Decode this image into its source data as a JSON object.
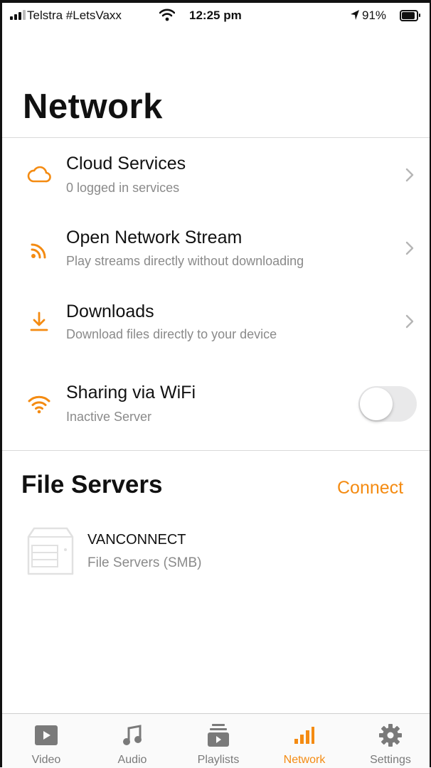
{
  "status_bar": {
    "carrier": "Telstra #LetsVaxx",
    "time": "12:25 pm",
    "battery_pct": "91%"
  },
  "page": {
    "title": "Network"
  },
  "colors": {
    "accent": "#f48b12",
    "secondary_text": "#8a8a8a",
    "toggle_off": "#e9e9ea"
  },
  "network_items": [
    {
      "title": "Cloud Services",
      "subtitle": "0 logged in services",
      "icon": "cloud-icon"
    },
    {
      "title": "Open Network Stream",
      "subtitle": "Play streams directly without downloading",
      "icon": "stream-icon"
    },
    {
      "title": "Downloads",
      "subtitle": "Download files directly to your device",
      "icon": "download-icon"
    },
    {
      "title": "Sharing via WiFi",
      "subtitle": "Inactive Server",
      "icon": "wifi-icon",
      "toggle_on": false
    }
  ],
  "file_servers": {
    "title": "File Servers",
    "connect_label": "Connect",
    "servers": [
      {
        "name": "VANCONNECT",
        "type": "File Servers (SMB)",
        "icon": "server-icon"
      }
    ]
  },
  "tabs": [
    {
      "label": "Video",
      "icon": "video-icon",
      "active": false
    },
    {
      "label": "Audio",
      "icon": "music-note-icon",
      "active": false
    },
    {
      "label": "Playlists",
      "icon": "playlist-icon",
      "active": false
    },
    {
      "label": "Network",
      "icon": "network-bars-icon",
      "active": true
    },
    {
      "label": "Settings",
      "icon": "gear-icon",
      "active": false
    }
  ]
}
